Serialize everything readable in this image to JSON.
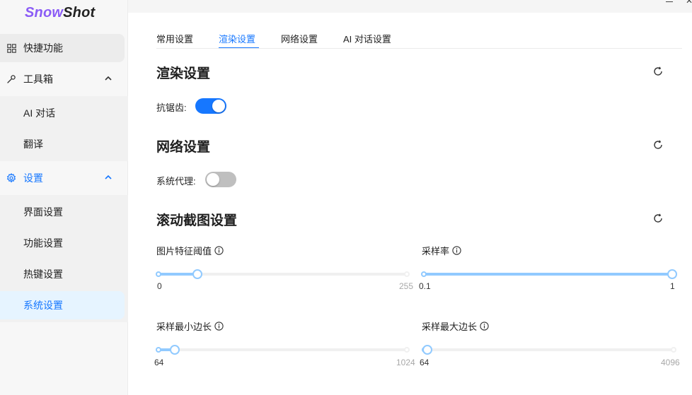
{
  "app": {
    "logo_part1": "Snow",
    "logo_part2": "Shot"
  },
  "sidebar": {
    "items": [
      {
        "label": "快捷功能",
        "icon": "grid-icon"
      },
      {
        "label": "工具箱",
        "icon": "wrench-icon",
        "expanded": true,
        "children": [
          "AI 对话",
          "翻译"
        ]
      },
      {
        "label": "设置",
        "icon": "gear-icon",
        "expanded": true,
        "children": [
          "界面设置",
          "功能设置",
          "热键设置",
          "系统设置"
        ]
      }
    ],
    "selected": "系统设置"
  },
  "tabs": [
    {
      "label": "常用设置",
      "active": false
    },
    {
      "label": "渲染设置",
      "active": true
    },
    {
      "label": "网络设置",
      "active": false
    },
    {
      "label": "AI 对话设置",
      "active": false
    }
  ],
  "render": {
    "title": "渲染设置",
    "antialias_label": "抗锯齿:",
    "antialias_on": true
  },
  "network": {
    "title": "网络设置",
    "proxy_label": "系统代理:",
    "proxy_on": false
  },
  "scroll": {
    "title": "滚动截图设置",
    "sliders": [
      {
        "label": "图片特征阈值",
        "min": "0",
        "max": "255",
        "value": 0.16
      },
      {
        "label": "采样率",
        "min": "0.1",
        "max": "1",
        "value": 1.0
      },
      {
        "label": "采样最小边长",
        "min": "64",
        "max": "1024",
        "value": 0.07
      },
      {
        "label": "采样最大边长",
        "min": "64",
        "max": "4096",
        "value": 0.01
      }
    ]
  },
  "colors": {
    "accent": "#1677ff",
    "slider": "#91caff",
    "logo": "#8b5cf6"
  }
}
